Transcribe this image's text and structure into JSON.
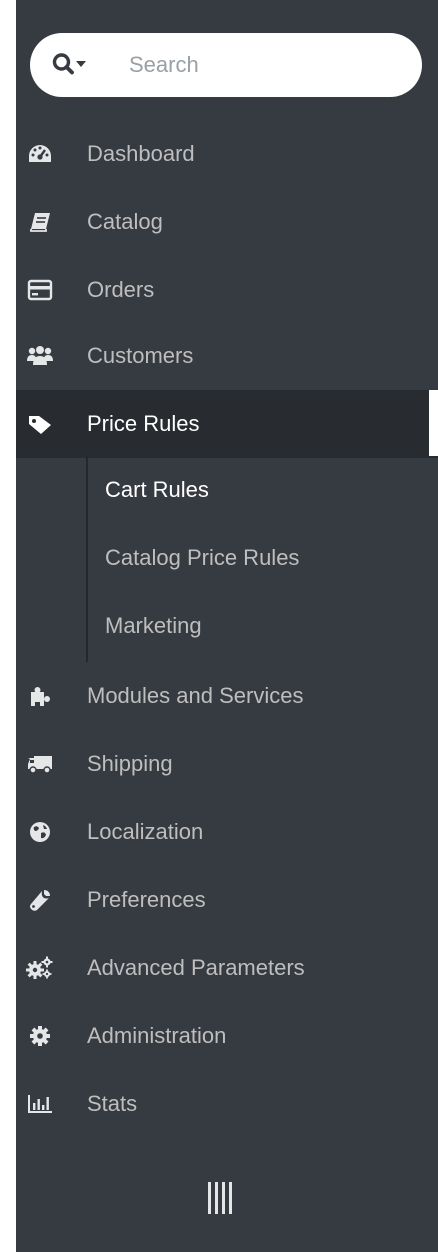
{
  "search": {
    "placeholder": "Search"
  },
  "nav": {
    "items": [
      {
        "label": "Dashboard",
        "icon": "dashboard-icon"
      },
      {
        "label": "Catalog",
        "icon": "book-icon"
      },
      {
        "label": "Orders",
        "icon": "credit-card-icon"
      },
      {
        "label": "Customers",
        "icon": "users-icon"
      },
      {
        "label": "Price Rules",
        "icon": "tag-icon",
        "active": true
      },
      {
        "label": "Modules and Services",
        "icon": "puzzle-icon"
      },
      {
        "label": "Shipping",
        "icon": "truck-icon"
      },
      {
        "label": "Localization",
        "icon": "globe-icon"
      },
      {
        "label": "Preferences",
        "icon": "wrench-icon"
      },
      {
        "label": "Advanced Parameters",
        "icon": "cogs-icon"
      },
      {
        "label": "Administration",
        "icon": "cog-icon"
      },
      {
        "label": "Stats",
        "icon": "bar-chart-icon"
      }
    ],
    "submenu": [
      {
        "label": "Cart Rules",
        "current": true
      },
      {
        "label": "Catalog Price Rules"
      },
      {
        "label": "Marketing"
      }
    ]
  },
  "colors": {
    "sidebar_bg": "#363a41",
    "active_bg": "#282b30",
    "text": "#bebebe",
    "active_text": "#ffffff"
  }
}
